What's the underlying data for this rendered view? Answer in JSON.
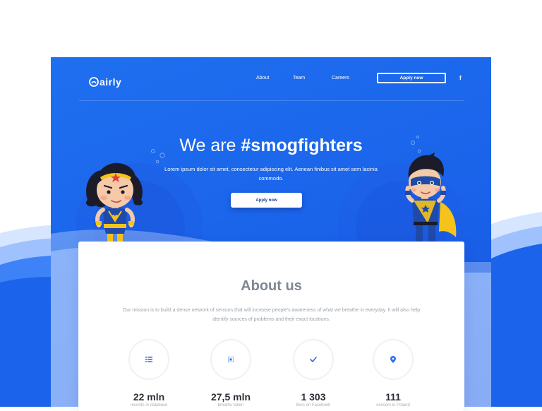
{
  "brand": {
    "name": "airly"
  },
  "nav": {
    "about": "About",
    "team": "Team",
    "careers": "Careers"
  },
  "header": {
    "apply_label": "Apply now",
    "facebook_icon": "facebook-icon"
  },
  "hero": {
    "title_light": "We are ",
    "title_bold": "#smogfighters",
    "subtitle": "Lorem ipsum dolor sit amet, consectetur adipiscing elit. Aenean finibus sit amet sem lacinia commodo.",
    "apply_label": "Apply now"
  },
  "about": {
    "title": "About us",
    "text": "Our mission is to build a dense network of sensors that will increase people's awareness of what we breathe in everyday. It will also help identify sources of problems and their exact locations."
  },
  "stats": [
    {
      "icon": "list-icon",
      "value": "22 mln",
      "label": "records in database"
    },
    {
      "icon": "sensor-icon",
      "value": "27,5 mln",
      "label": "breaths taken"
    },
    {
      "icon": "check-icon",
      "value": "1 303",
      "label": "likes on Facebook"
    },
    {
      "icon": "location-pin-icon",
      "value": "111",
      "label": "sensors in Poland"
    }
  ],
  "colors": {
    "primary": "#1a63ea",
    "accent_icon": "#2f6df0",
    "heading_gray": "#7e8793"
  }
}
